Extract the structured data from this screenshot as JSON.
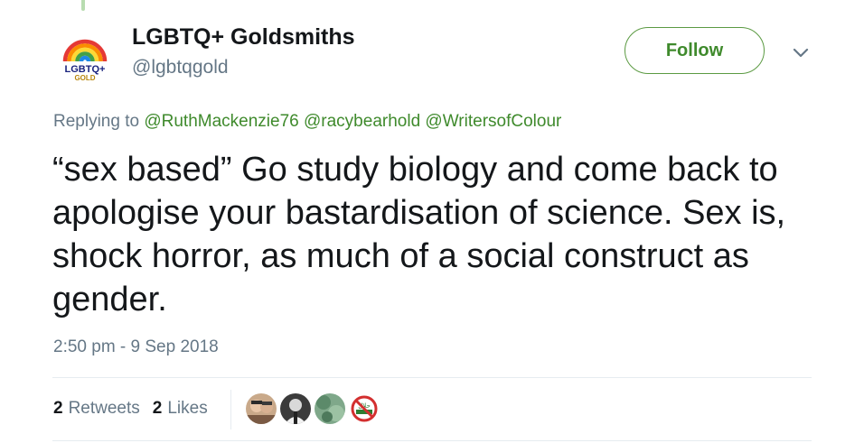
{
  "author": {
    "display_name": "LGBTQ+ Goldsmiths",
    "handle": "@lgbtqgold",
    "avatar_text_top": "LGBTQ+",
    "avatar_text_bottom": "GOLD"
  },
  "follow_label": "Follow",
  "reply": {
    "prefix": "Replying to",
    "mentions": [
      "@RuthMackenzie76",
      "@racybearhold",
      "@WritersofColour"
    ]
  },
  "tweet_text": "“sex based” Go study biology and come back to apologise your bastardisation of science. Sex is, shock horror, as much of a social construct as gender.",
  "timestamp": "2:50 pm - 9 Sep 2018",
  "stats": {
    "retweets_count": "2",
    "retweets_label": "Retweets",
    "likes_count": "2",
    "likes_label": "Likes"
  },
  "icons": {
    "caret": "chevron-down-icon"
  },
  "colors": {
    "accent_green": "#3f8a2c",
    "muted_text": "#657786"
  }
}
